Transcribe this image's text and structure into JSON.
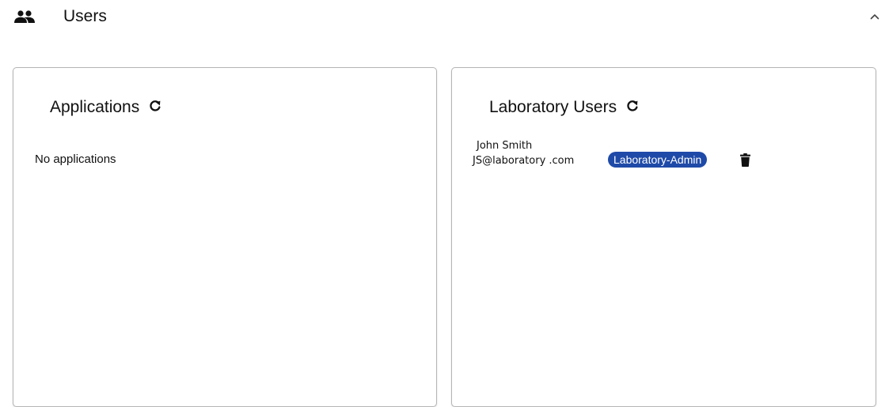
{
  "header": {
    "title": "Users",
    "icon": "group-icon",
    "toggle_icon": "chevron-up-icon"
  },
  "applications_card": {
    "title": "Applications",
    "refresh_icon": "refresh-icon",
    "empty_text": "No applications"
  },
  "users_card": {
    "title": "Laboratory Users",
    "refresh_icon": "refresh-icon",
    "users": [
      {
        "name": "John Smith",
        "email": "JS@laboratory .com",
        "role": "Laboratory-Admin",
        "delete_icon": "trash-icon"
      }
    ]
  },
  "colors": {
    "role_badge_bg": "#1f4aa8",
    "role_badge_text": "#ffffff",
    "card_border": "#b5b5b5",
    "text": "#111111"
  }
}
